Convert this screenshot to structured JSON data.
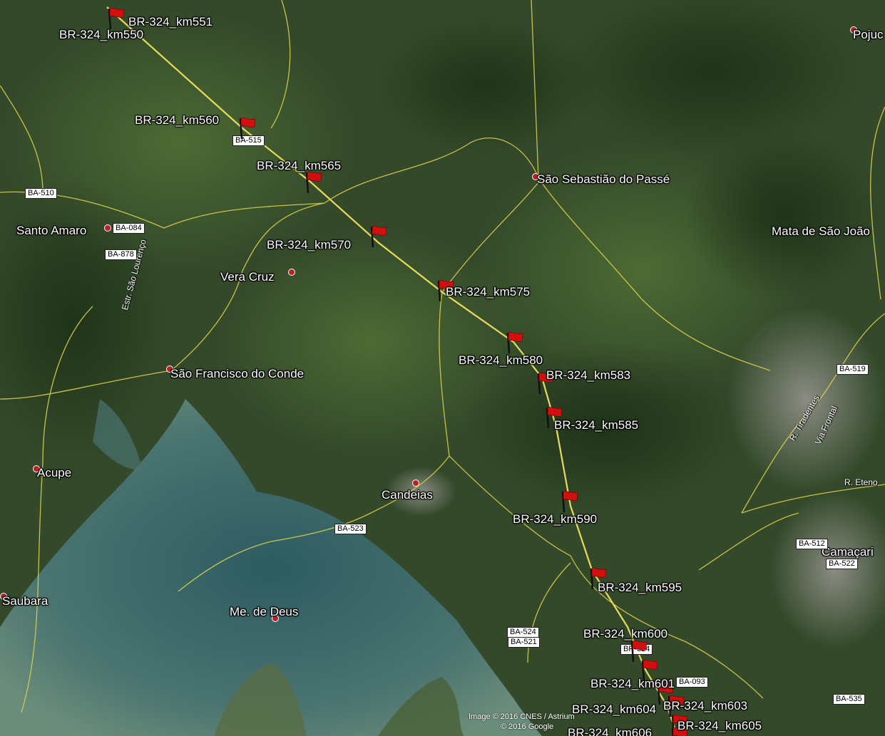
{
  "markers": [
    {
      "label": "BR-324_km551"
    },
    {
      "label": "BR-324_km550"
    },
    {
      "label": "BR-324_km560"
    },
    {
      "label": "BR-324_km565"
    },
    {
      "label": "BR-324_km570"
    },
    {
      "label": "BR-324_km575"
    },
    {
      "label": "BR-324_km580"
    },
    {
      "label": "BR-324_km583"
    },
    {
      "label": "BR-324_km585"
    },
    {
      "label": "BR-324_km590"
    },
    {
      "label": "BR-324_km595"
    },
    {
      "label": "BR-324_km600"
    },
    {
      "label": "BR-324_km601"
    },
    {
      "label": "BR-324_km603"
    },
    {
      "label": "BR-324_km604"
    },
    {
      "label": "BR-324_km605"
    },
    {
      "label": "BR-324_km606"
    }
  ],
  "places": [
    {
      "name": "Pojuc"
    },
    {
      "name": "São Sebastião do Passé"
    },
    {
      "name": "Santo Amaro"
    },
    {
      "name": "Vera Cruz"
    },
    {
      "name": "Mata de São João"
    },
    {
      "name": "São Francisco do Conde"
    },
    {
      "name": "Acupe"
    },
    {
      "name": "Candeias"
    },
    {
      "name": "Camaçari"
    },
    {
      "name": "Saubara"
    },
    {
      "name": "Me. de Deus"
    }
  ],
  "road_shields": [
    "BA-515",
    "BA-510",
    "BA-084",
    "BA-878",
    "BA-523",
    "BA-524",
    "BA-521",
    "BA-519",
    "BA-512",
    "BA-522",
    "BA-535",
    "BR-324",
    "BA-093"
  ],
  "road_labels": [
    "Estr. São Lourenço",
    "R. Tiradentes",
    "Via Frontal",
    "R. Eteno"
  ],
  "credits": {
    "line1": "Image © 2016 CNES / Astrium",
    "line2": "© 2016 Google"
  },
  "colors": {
    "flag_red": "#d10f0f",
    "road_yellow": "#e8dc5a",
    "water": "#3f6a68",
    "vegetation": "#2f4a24"
  }
}
